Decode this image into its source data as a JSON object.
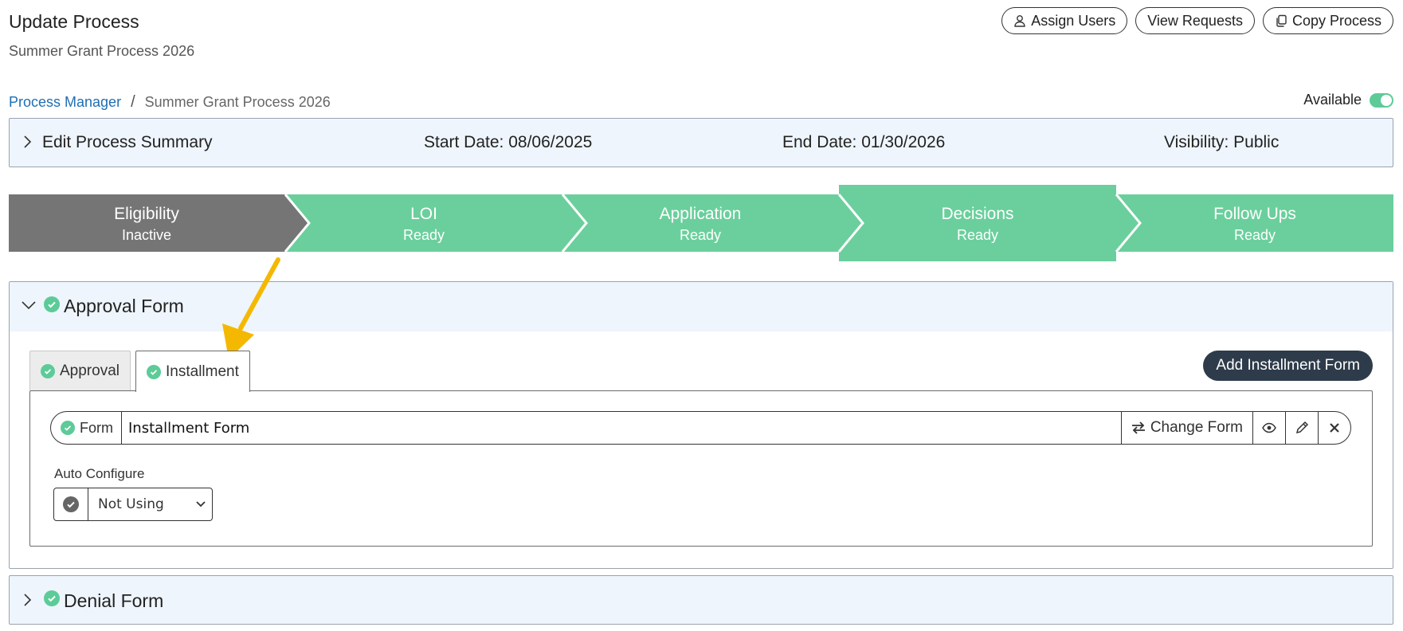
{
  "header": {
    "title": "Update Process",
    "subtitle": "Summer Grant Process 2026"
  },
  "actions": {
    "assign_users": "Assign Users",
    "view_requests": "View Requests",
    "copy_process": "Copy Process"
  },
  "breadcrumb": {
    "root": "Process Manager",
    "separator": "/",
    "current": "Summer Grant Process 2026"
  },
  "availability": {
    "label": "Available",
    "enabled": true
  },
  "summary": {
    "edit_label": "Edit Process Summary",
    "start_date": "Start Date: 08/06/2025",
    "end_date": "End Date: 01/30/2026",
    "visibility": "Visibility: Public"
  },
  "stages": [
    {
      "name": "Eligibility",
      "status": "Inactive"
    },
    {
      "name": "LOI",
      "status": "Ready"
    },
    {
      "name": "Application",
      "status": "Ready"
    },
    {
      "name": "Decisions",
      "status": "Ready",
      "selected": true
    },
    {
      "name": "Follow Ups",
      "status": "Ready"
    }
  ],
  "approval_panel": {
    "title": "Approval Form",
    "tabs": [
      {
        "label": "Approval"
      },
      {
        "label": "Installment",
        "active": true
      }
    ],
    "add_button": "Add Installment Form",
    "form_row": {
      "label": "Form",
      "value": "Installment Form",
      "change_label": "Change Form"
    },
    "auto_configure": {
      "label": "Auto Configure",
      "selected": "Not Using"
    }
  },
  "denial_panel": {
    "title": "Denial Form"
  },
  "colors": {
    "accent_green": "#6acf9c",
    "inactive_gray": "#757575",
    "link_blue": "#1f6fb2",
    "panel_bg": "#eef5fc",
    "dark_button": "#2e3b4a",
    "arrow_yellow": "#f5b800"
  }
}
